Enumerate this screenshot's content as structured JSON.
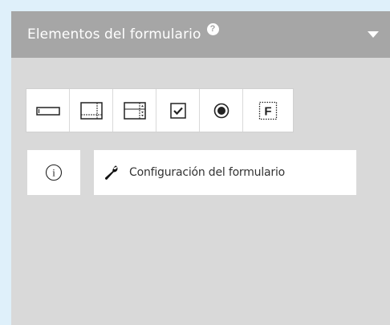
{
  "panel": {
    "title": "Elementos del formulario",
    "help_glyph": "?",
    "toggle_icon": "caret-down-icon"
  },
  "toolbar": {
    "items": [
      {
        "name": "text-field",
        "icon": "text-field-icon"
      },
      {
        "name": "textarea",
        "icon": "textarea-icon"
      },
      {
        "name": "select",
        "icon": "select-dropdown-icon"
      },
      {
        "name": "checkbox",
        "icon": "checkbox-icon"
      },
      {
        "name": "radio",
        "icon": "radio-button-icon"
      },
      {
        "name": "file",
        "icon": "file-field-icon",
        "glyph": "F"
      }
    ]
  },
  "info": {
    "glyph": "i",
    "icon": "info-icon"
  },
  "config": {
    "label": "Configuración del formulario",
    "icon": "wrench-icon"
  },
  "colors": {
    "background": "#dff0fa",
    "panel": "#d9d9d9",
    "header": "#a6a6a6",
    "button": "#ffffff",
    "icon": "#222222"
  }
}
